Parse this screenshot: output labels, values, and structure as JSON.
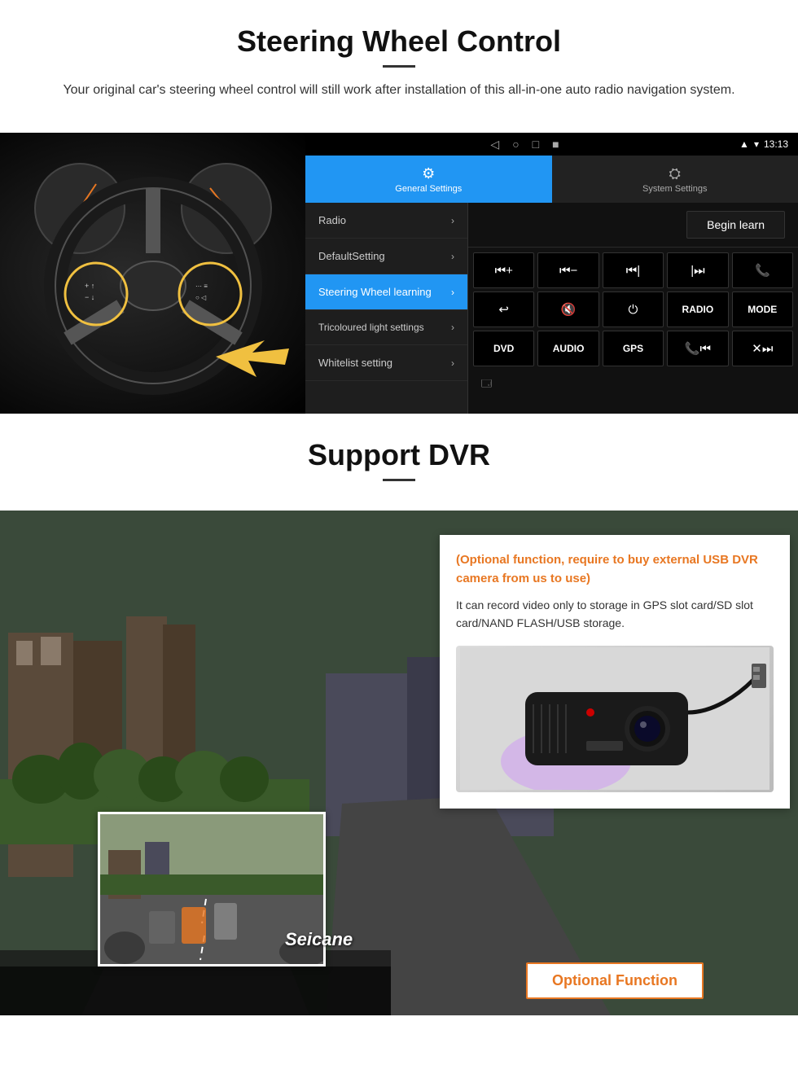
{
  "section1": {
    "title": "Steering Wheel Control",
    "description": "Your original car's steering wheel control will still work after installation of this all-in-one auto radio navigation system.",
    "status_bar": {
      "time": "13:13",
      "nav_icons": [
        "◁",
        "○",
        "□",
        "■"
      ]
    },
    "tabs": {
      "general": {
        "label": "General Settings",
        "icon": "⚙"
      },
      "system": {
        "label": "System Settings",
        "icon": "🌐"
      }
    },
    "menu_items": [
      {
        "label": "Radio",
        "active": false
      },
      {
        "label": "DefaultSetting",
        "active": false
      },
      {
        "label": "Steering Wheel learning",
        "active": true
      },
      {
        "label": "Tricoloured light settings",
        "active": false
      },
      {
        "label": "Whitelist setting",
        "active": false
      }
    ],
    "begin_learn_label": "Begin learn",
    "control_buttons": [
      "⏮+",
      "⏮−",
      "⏮|",
      "|⏭",
      "📞",
      "↩",
      "🔇",
      "⏻",
      "RADIO",
      "MODE",
      "DVD",
      "AUDIO",
      "GPS",
      "📞⏮",
      "✕⏭"
    ]
  },
  "section2": {
    "title": "Support DVR",
    "optional_text": "(Optional function, require to buy external USB DVR camera from us to use)",
    "description": "It can record video only to storage in GPS slot card/SD slot card/NAND FLASH/USB storage.",
    "optional_badge": "Optional Function",
    "brand": "Seicane"
  }
}
